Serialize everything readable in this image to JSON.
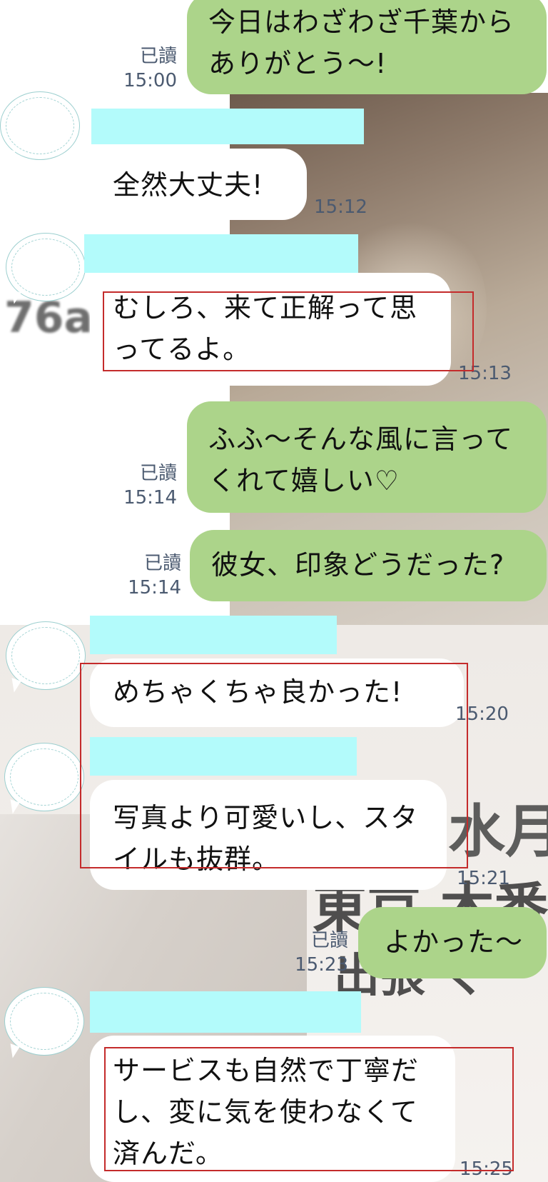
{
  "messages": [
    {
      "dir": "out",
      "text": "今日はわざわざ千葉から\nありがとう〜!",
      "read": "已讀",
      "time": "15:00"
    },
    {
      "dir": "in",
      "text": "全然大丈夫!",
      "time": "15:12"
    },
    {
      "dir": "in",
      "text": "むしろ、来て正解って思\nってるよ。",
      "time": "15:13"
    },
    {
      "dir": "out",
      "text": "ふふ〜そんな風に言って\nくれて嬉しい♡",
      "read": "已讀",
      "time": "15:14"
    },
    {
      "dir": "out",
      "text": "彼女、印象どうだった?",
      "read": "已讀",
      "time": "15:14"
    },
    {
      "dir": "in",
      "text": "めちゃくちゃ良かった!",
      "time": "15:20"
    },
    {
      "dir": "in",
      "text": "写真より可愛いし、スタ\nイルも抜群。",
      "time": "15:21"
    },
    {
      "dir": "out",
      "text": "よかった〜",
      "read": "已讀",
      "time": "15:23"
    },
    {
      "dir": "in",
      "text": "サービスも自然で丁寧だ\nし、変に気を使わなくて\n済んだ。",
      "time": "15:25"
    }
  ],
  "background": {
    "watermark": "76a",
    "poster_line1": "水月",
    "poster_line2": "東京 木番",
    "poster_line3": "出張 ぐ"
  },
  "colors": {
    "outgoing_bubble": "#acd48a",
    "incoming_bubble": "#ffffff",
    "name_redaction": "#b3fbfb",
    "highlight_box": "#c42b2b",
    "meta_text": "#4b5a70"
  }
}
